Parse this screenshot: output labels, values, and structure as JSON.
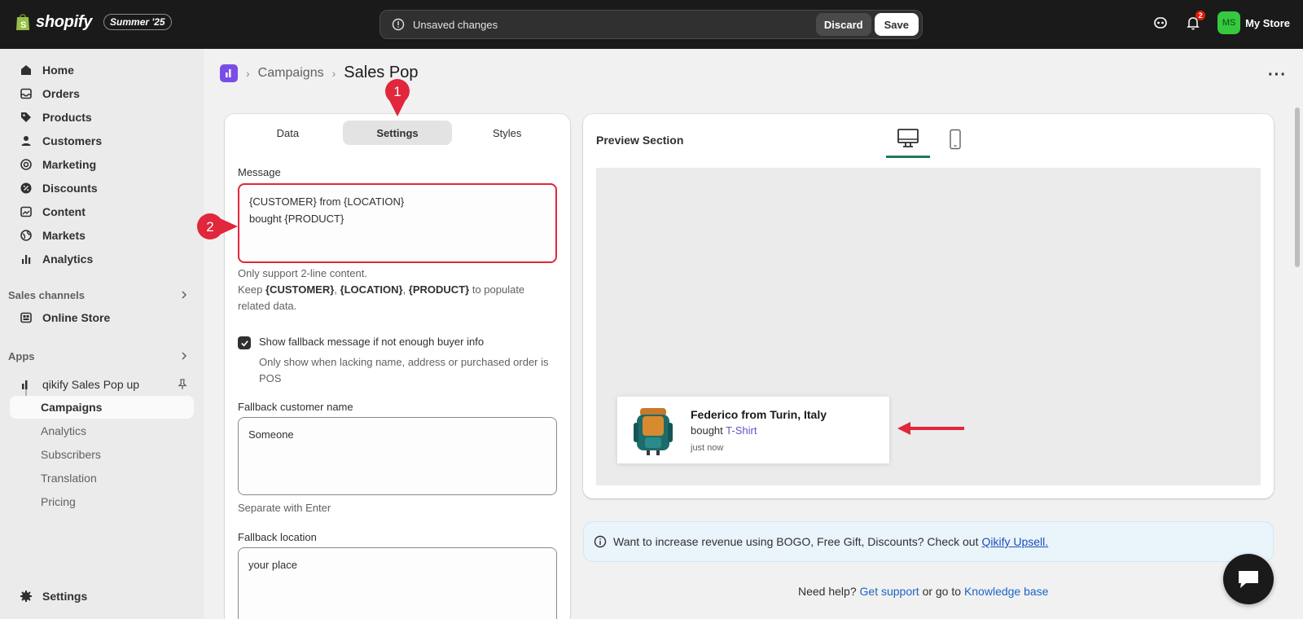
{
  "topbar": {
    "brand": "shopify",
    "edition": "Summer '25",
    "unsaved_message": "Unsaved changes",
    "discard_label": "Discard",
    "save_label": "Save",
    "notifications_count": "2",
    "store_initials": "MS",
    "store_name": "My Store"
  },
  "sidebar": {
    "items": [
      {
        "label": "Home",
        "icon": "home-icon"
      },
      {
        "label": "Orders",
        "icon": "inbox-icon"
      },
      {
        "label": "Products",
        "icon": "tag-icon"
      },
      {
        "label": "Customers",
        "icon": "person-icon"
      },
      {
        "label": "Marketing",
        "icon": "target-icon"
      },
      {
        "label": "Discounts",
        "icon": "discount-icon"
      },
      {
        "label": "Content",
        "icon": "image-icon"
      },
      {
        "label": "Markets",
        "icon": "globe-icon"
      },
      {
        "label": "Analytics",
        "icon": "bar-chart-icon"
      }
    ],
    "sales_channels_heading": "Sales channels",
    "online_store": "Online Store",
    "apps_heading": "Apps",
    "app_name": "qikify Sales Pop up",
    "app_subitems": [
      "Campaigns",
      "Analytics",
      "Subscribers",
      "Translation",
      "Pricing"
    ],
    "settings": "Settings"
  },
  "breadcrumb": {
    "parent": "Campaigns",
    "current": "Sales Pop"
  },
  "tabs": [
    "Data",
    "Settings",
    "Styles"
  ],
  "form": {
    "message_label": "Message",
    "message_value": "{CUSTOMER} from {LOCATION}\nbought {PRODUCT}",
    "message_help_1": "Only support 2-line content.",
    "message_help_keep": "Keep",
    "message_help_tokens": [
      "{CUSTOMER}",
      "{LOCATION}",
      "{PRODUCT}"
    ],
    "message_help_tail": "to populate related data.",
    "fallback_check_label": "Show fallback message if not enough buyer info",
    "fallback_check_help": "Only show when lacking name, address or purchased order is POS",
    "fallback_name_label": "Fallback customer name",
    "fallback_name_value": "Someone",
    "fallback_name_help": "Separate with Enter",
    "fallback_location_label": "Fallback location",
    "fallback_location_value": "your place"
  },
  "preview": {
    "title": "Preview Section",
    "popup_title": "Federico from Turin, Italy",
    "popup_bought": "bought",
    "popup_product": "T-Shirt",
    "popup_time": "just now"
  },
  "banner": {
    "text": "Want to increase revenue using BOGO, Free Gift, Discounts? Check out",
    "link": "Qikify Upsell."
  },
  "help": {
    "prefix": "Need help?",
    "support_link": "Get support",
    "middle": "or go to",
    "kb_link": "Knowledge base"
  },
  "annotations": {
    "step1": "1",
    "step2": "2"
  }
}
